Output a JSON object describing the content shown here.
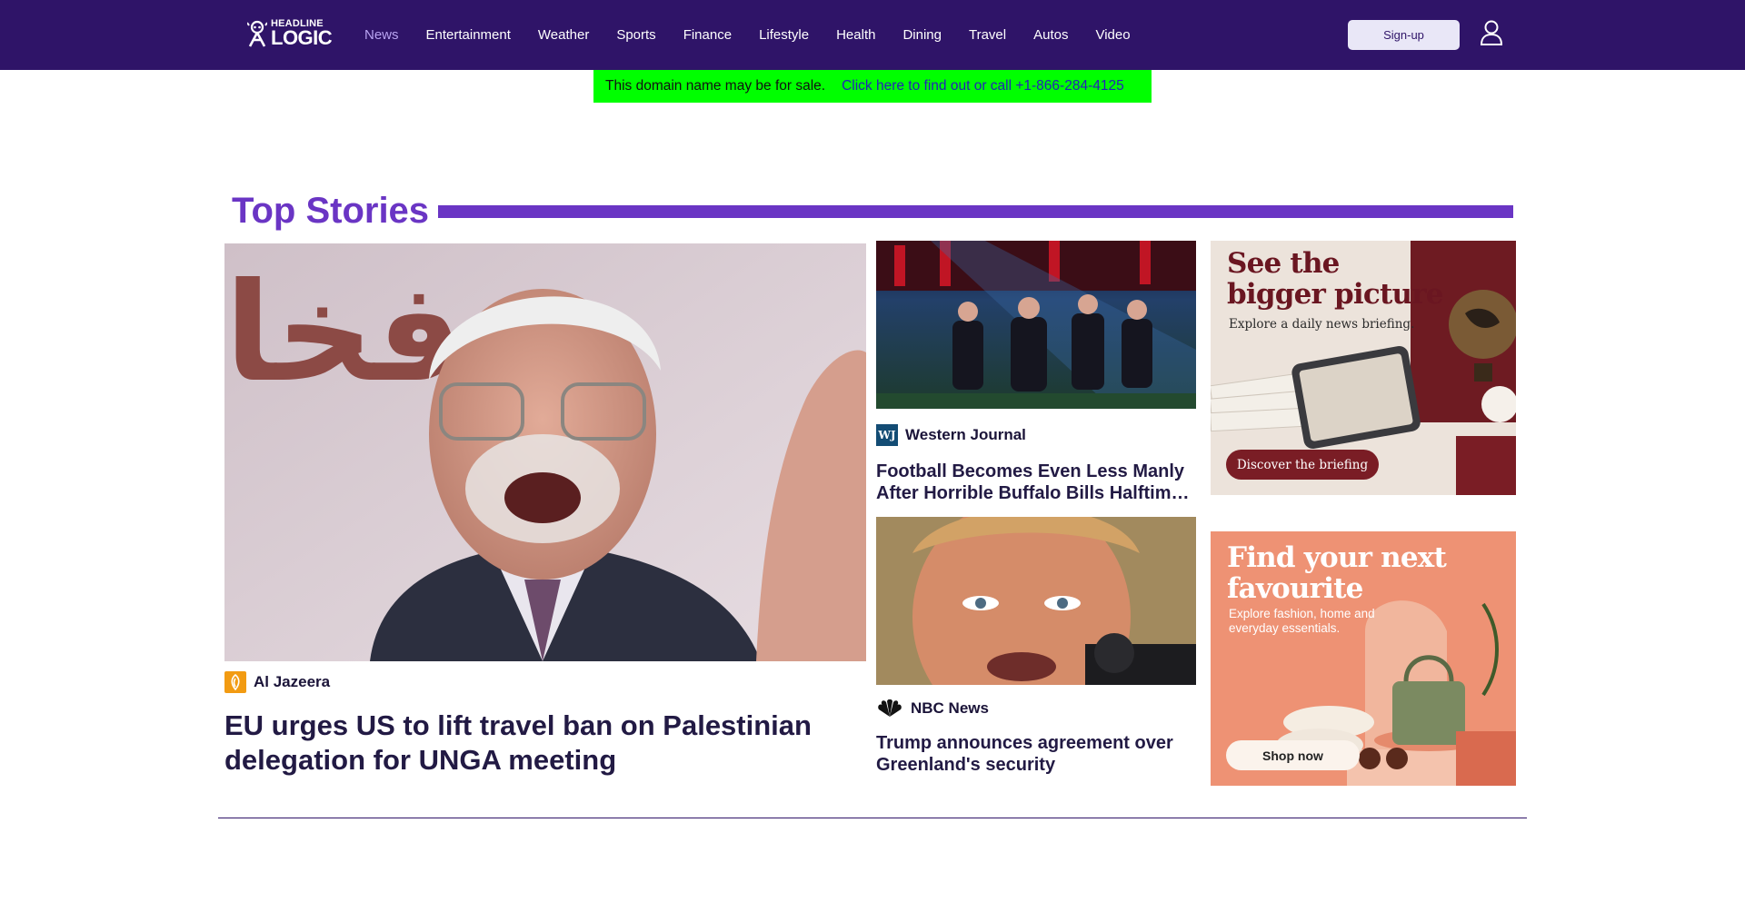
{
  "brand": {
    "logo_top": "HEADLINE",
    "logo_bottom": "LOGIC",
    "color": "#2f1468"
  },
  "nav": {
    "items": [
      {
        "label": "News",
        "active": true
      },
      {
        "label": "Entertainment"
      },
      {
        "label": "Weather"
      },
      {
        "label": "Sports"
      },
      {
        "label": "Finance"
      },
      {
        "label": "Lifestyle"
      },
      {
        "label": "Health"
      },
      {
        "label": "Dining"
      },
      {
        "label": "Travel"
      },
      {
        "label": "Autos"
      },
      {
        "label": "Video"
      }
    ],
    "signup_label": "Sign-up",
    "user_icon": "user-icon"
  },
  "sale_banner": {
    "text": "This domain name may be for sale.",
    "link": "Click here to find out or call +1-866-284-4125",
    "color": "#00ff00"
  },
  "top_stories": {
    "title": "Top Stories",
    "accent": "#6a35c4",
    "main": {
      "source": "Al Jazeera",
      "source_icon": "al-jazeera-logo-icon",
      "headline": "EU urges US to lift travel ban on Palestinian delegation for UNGA meeting",
      "image_text": "فخا"
    },
    "cards": [
      {
        "source": "Western Journal",
        "source_icon": "western-journal-logo-icon",
        "source_mark": "WJ",
        "headline": "Football Becomes Even Less Manly After Horrible Buffalo Bills Halftime Show"
      },
      {
        "source": "NBC News",
        "source_icon": "nbc-peacock-icon",
        "headline": "Trump announces agreement over Greenland's security"
      }
    ]
  },
  "ads": [
    {
      "title": "See the bigger picture",
      "subtitle": "Explore a daily news briefing.",
      "cta": "Discover the briefing"
    },
    {
      "title": "Find your next favourite",
      "subtitle": "Explore fashion, home and everyday essentials.",
      "cta": "Shop now"
    }
  ]
}
